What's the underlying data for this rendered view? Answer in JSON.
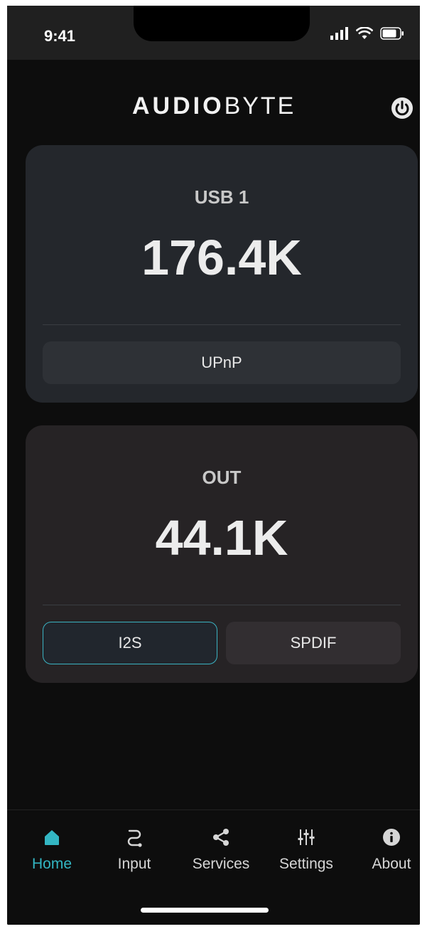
{
  "status": {
    "time": "9:41",
    "icons": [
      "signal-icon",
      "wifi-icon",
      "battery-icon"
    ]
  },
  "header": {
    "logo_bold": "AUDIO",
    "logo_thin": "BYTE",
    "power_icon": "power-icon"
  },
  "input_card": {
    "label": "USB 1",
    "rate": "176.4K",
    "source": "UPnP"
  },
  "output_card": {
    "label": "OUT",
    "rate": "44.1K",
    "options": [
      "I2S",
      "SPDIF"
    ],
    "selected": "I2S"
  },
  "tabs": [
    {
      "label": "Home",
      "icon": "home-icon",
      "active": true
    },
    {
      "label": "Input",
      "icon": "input-icon",
      "active": false
    },
    {
      "label": "Services",
      "icon": "share-icon",
      "active": false
    },
    {
      "label": "Settings",
      "icon": "sliders-icon",
      "active": false
    },
    {
      "label": "About",
      "icon": "info-icon",
      "active": false
    }
  ],
  "colors": {
    "accent": "#33b6c3",
    "background": "#0d0d0d",
    "card_in": "#24272c",
    "card_out": "#262325"
  }
}
